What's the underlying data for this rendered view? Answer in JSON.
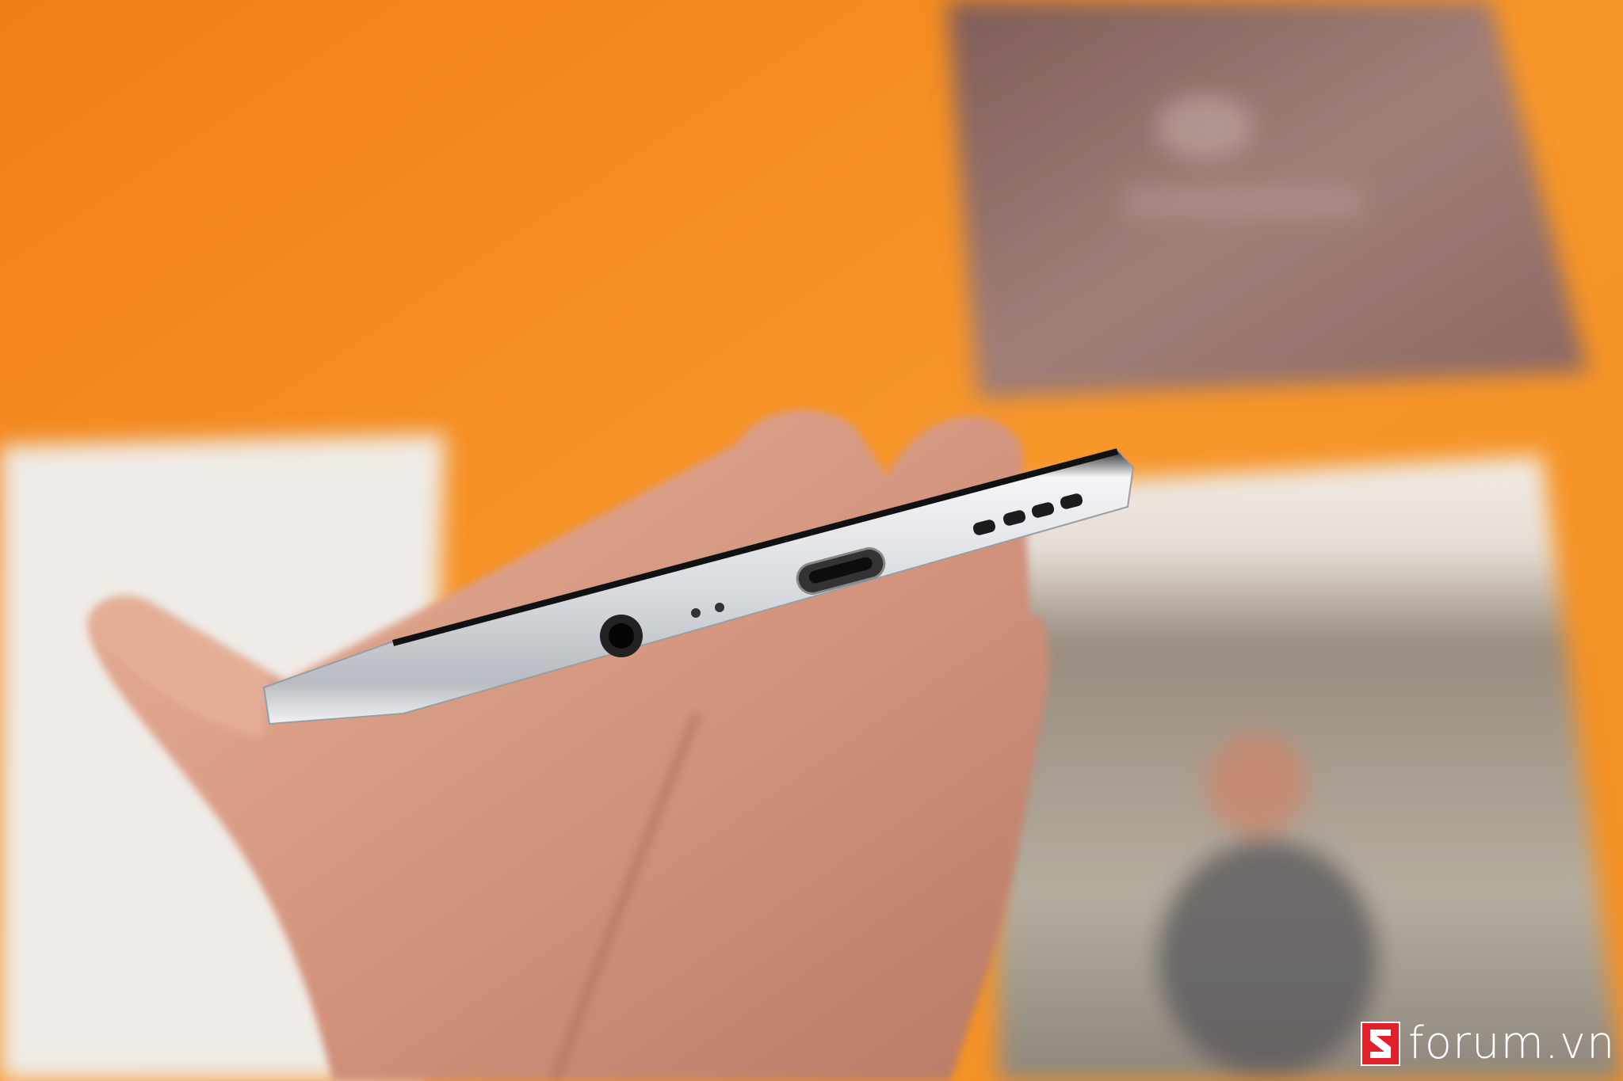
{
  "watermark": {
    "text": "forum.vn",
    "logo_letter": "S",
    "logo_color": "#e0202a"
  },
  "colors": {
    "background": "#f28a1c",
    "poster": "#8c6762",
    "card": "#efebe6",
    "yellow": "#ffcf0a",
    "skin": "#d79a80",
    "phone": "#d9dbde"
  }
}
